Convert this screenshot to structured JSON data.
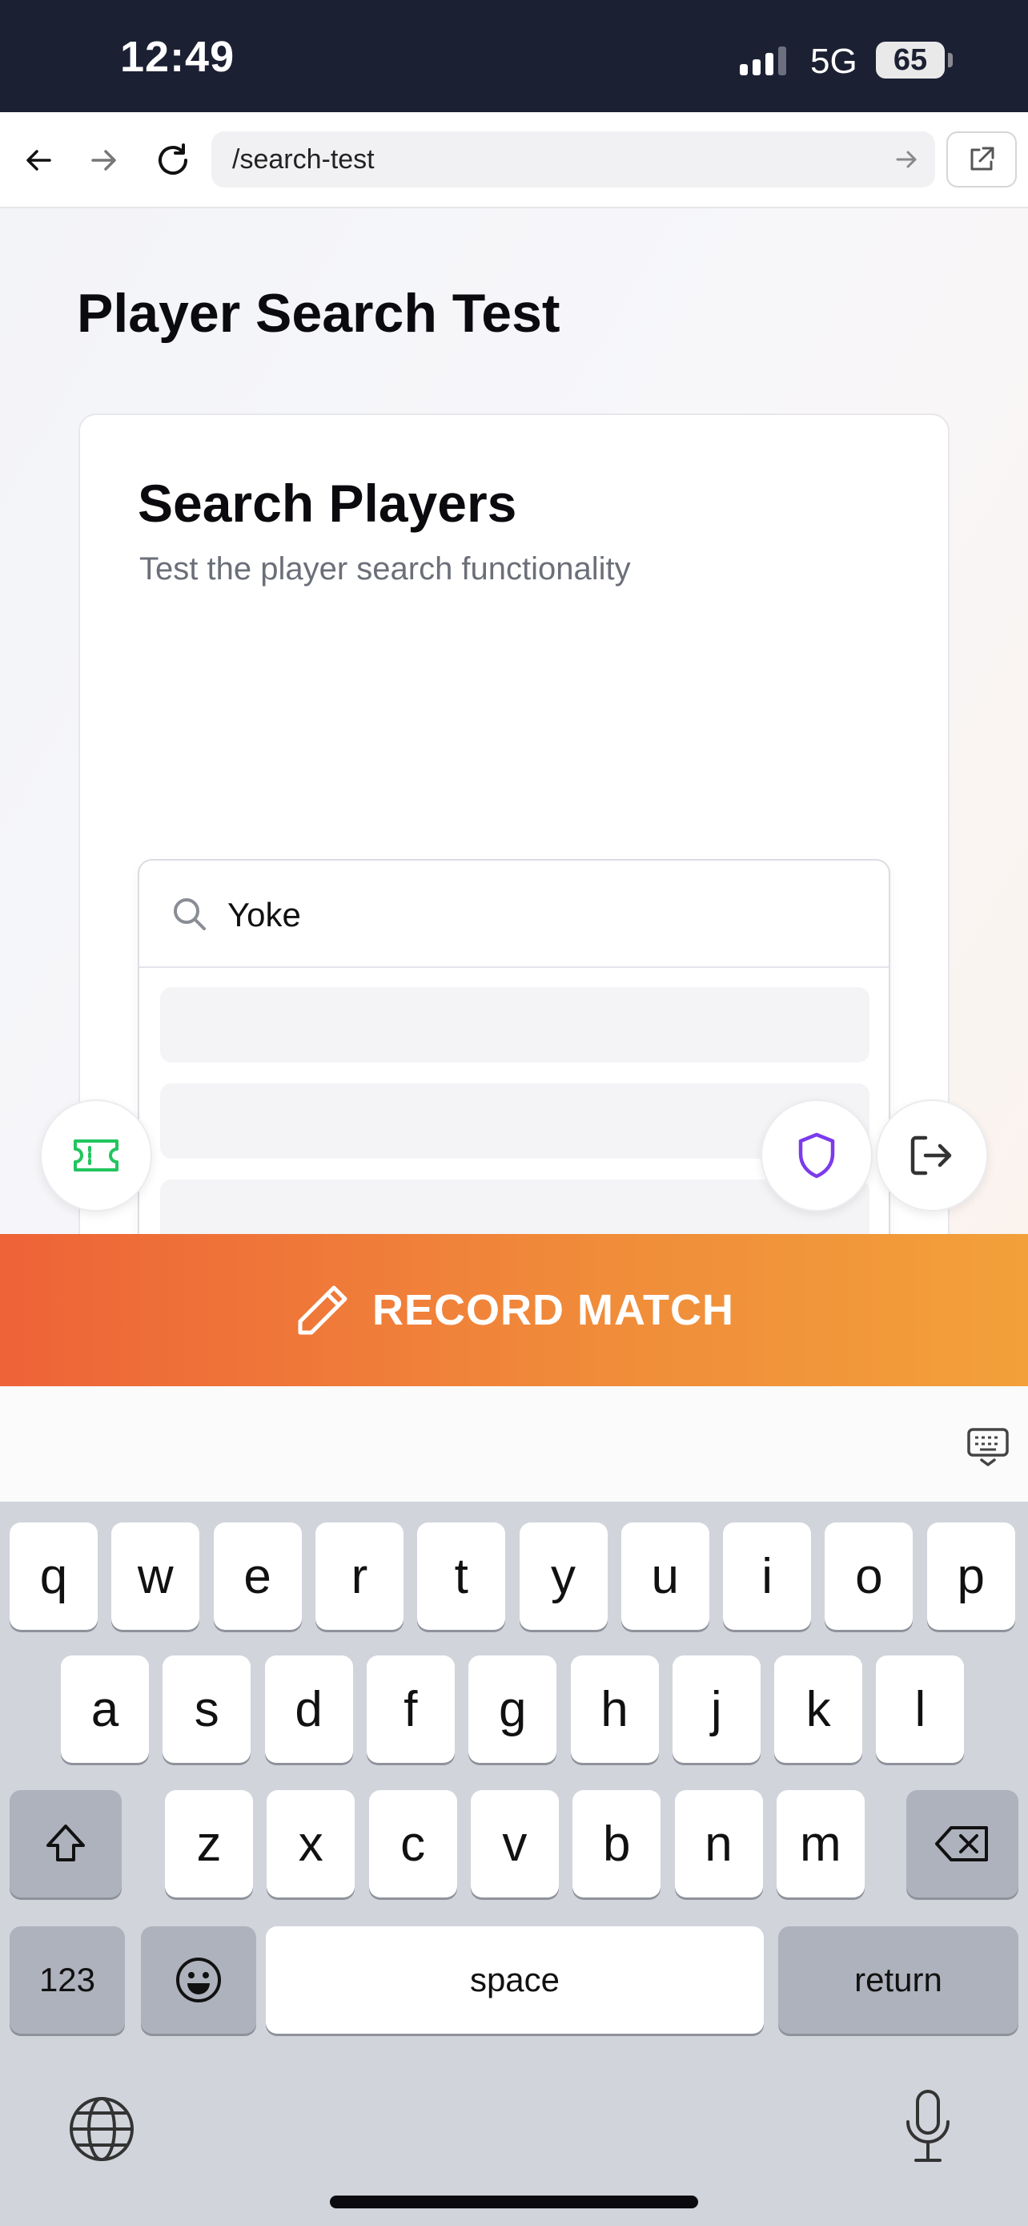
{
  "status_bar": {
    "time": "12:49",
    "network": "5G",
    "battery": "65"
  },
  "browser": {
    "url": "/search-test"
  },
  "page": {
    "title": "Player Search Test",
    "card": {
      "title": "Search Players",
      "subtitle": "Test the player search functionality",
      "search": {
        "value": "Yoke",
        "placeholder": ""
      }
    }
  },
  "record_button": {
    "label": "RECORD MATCH"
  },
  "keyboard": {
    "row1": [
      "q",
      "w",
      "e",
      "r",
      "t",
      "y",
      "u",
      "i",
      "o",
      "p"
    ],
    "row2": [
      "a",
      "s",
      "d",
      "f",
      "g",
      "h",
      "j",
      "k",
      "l"
    ],
    "row3": [
      "z",
      "x",
      "c",
      "v",
      "b",
      "n",
      "m"
    ],
    "numbers_label": "123",
    "space_label": "space",
    "return_label": "return"
  },
  "colors": {
    "accent_start": "#ee6338",
    "accent_end": "#f2a03a",
    "shield": "#7c3aed",
    "ticket": "#22c55e"
  }
}
